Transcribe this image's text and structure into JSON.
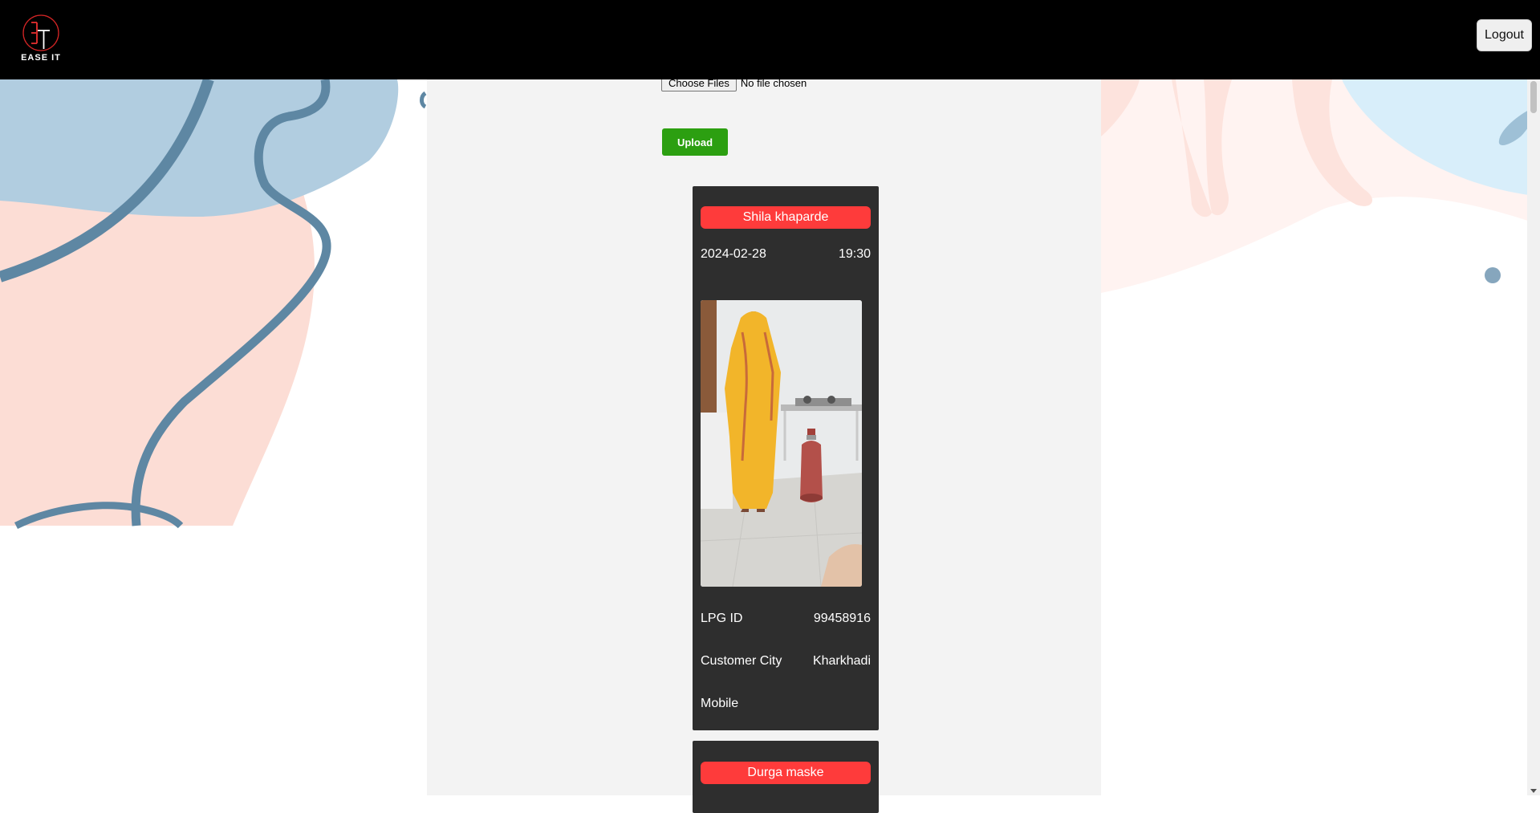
{
  "app": {
    "logo_text": "EASE IT",
    "logout_label": "Logout"
  },
  "upload": {
    "choose_label": "Choose Files",
    "no_file_text": "No file chosen",
    "upload_label": "Upload"
  },
  "cards": [
    {
      "name": "Shila khaparde",
      "date": "2024-02-28",
      "time": "19:30",
      "lpg_label": "LPG ID",
      "lpg_id": "99458916",
      "city_label": "Customer City",
      "city": "Kharkhadi",
      "mobile_label": "Mobile",
      "mobile": ""
    },
    {
      "name": "Durga maske"
    }
  ],
  "colors": {
    "topbar": "#000000",
    "panel": "#f3f3f3",
    "card": "#2e2e2e",
    "name_pill": "#fe3b3b",
    "upload_button": "#2c9f11"
  }
}
